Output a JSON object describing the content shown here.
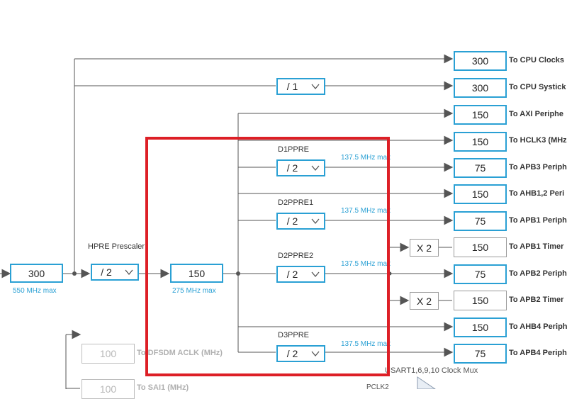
{
  "source": {
    "value": "300",
    "max": "550 MHz max"
  },
  "hpre": {
    "label": "HPRE Prescaler",
    "value": "/ 2"
  },
  "hclk": {
    "value": "150",
    "max": "275 MHz max"
  },
  "systick_div": {
    "value": "/ 1"
  },
  "d1ppre": {
    "label": "D1PPRE",
    "value": "/ 2",
    "max": "137.5 MHz max"
  },
  "d2ppre1": {
    "label": "D2PPRE1",
    "value": "/ 2",
    "max": "137.5 MHz max"
  },
  "d2ppre2": {
    "label": "D2PPRE2",
    "value": "/ 2",
    "max": "137.5 MHz max"
  },
  "d3ppre": {
    "label": "D3PPRE",
    "value": "/ 2",
    "max": "137.5 MHz max"
  },
  "outputs": {
    "cpu": {
      "value": "300",
      "label": "To CPU Clocks"
    },
    "systick": {
      "value": "300",
      "label": "To CPU Systick"
    },
    "axi": {
      "value": "150",
      "label": "To AXI Periphe"
    },
    "hclk3": {
      "value": "150",
      "label": "To HCLK3 (MHz"
    },
    "apb3": {
      "value": "75",
      "label": "To APB3 Periph"
    },
    "ahb12": {
      "value": "150",
      "label": "To AHB1,2 Peri"
    },
    "apb1": {
      "value": "75",
      "label": "To APB1 Periph"
    },
    "apb1_timer": {
      "mult": "X 2",
      "value": "150",
      "label": "To APB1 Timer"
    },
    "apb2": {
      "value": "75",
      "label": "To APB2 Periph"
    },
    "apb2_timer": {
      "mult": "X 2",
      "value": "150",
      "label": "To APB2 Timer"
    },
    "ahb4": {
      "value": "150",
      "label": "To AHB4 Periph"
    },
    "apb4": {
      "value": "75",
      "label": "To APB4 Periph"
    }
  },
  "disabled": {
    "dfsdm": {
      "value": "100",
      "label": "To DFSDM ACLK (MHz)"
    },
    "sai1": {
      "value": "100",
      "label": "To SAI1 (MHz)"
    }
  },
  "usart_mux": {
    "label": "USART1,6,9,10 Clock Mux"
  },
  "pclk2": {
    "label": "PCLK2"
  }
}
